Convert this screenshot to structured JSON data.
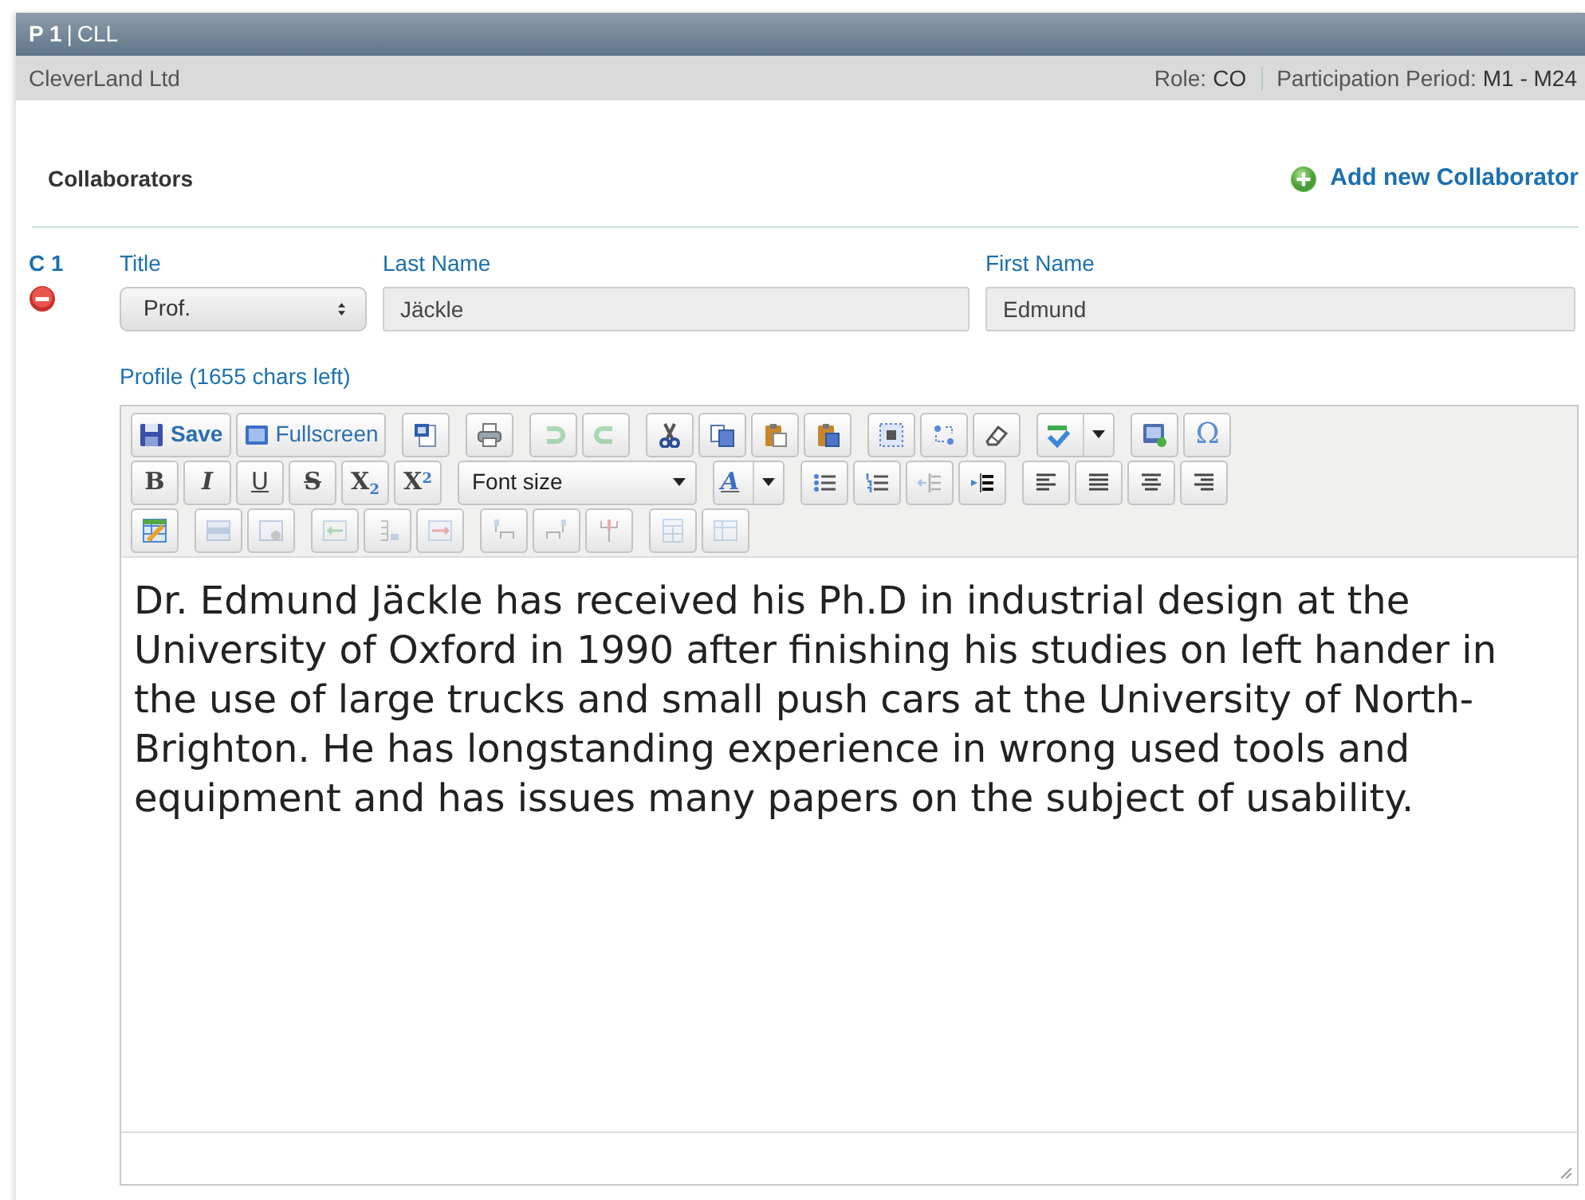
{
  "partner_header": {
    "number": "P 1",
    "separator": "|",
    "acronym": "CLL"
  },
  "partner_info": {
    "name": "CleverLand Ltd",
    "role_label": "Role:",
    "role_value": "CO",
    "period_label": "Participation Period:",
    "period_value": "M1 - M24"
  },
  "collaborators": {
    "title": "Collaborators",
    "add_link": "Add new Collaborator",
    "items": [
      {
        "code": "C 1",
        "title_label": "Title",
        "title_value": "Prof.",
        "last_name_label": "Last Name",
        "last_name": "Jäckle",
        "first_name_label": "First Name",
        "first_name": "Edmund",
        "profile_label": "Profile (1655 chars left)",
        "toolbar": [
          [
            [
              {
                "kind": "text",
                "label": "Save",
                "disabled": false
              },
              {
                "kind": "text",
                "label": "Fullscreen",
                "disabled": false
              }
            ],
            [
              {
                "kind": "icon",
                "disabled": false
              }
            ],
            [
              {
                "kind": "icon",
                "disabled": false
              }
            ],
            [
              {
                "kind": "icon",
                "disabled": true
              },
              {
                "kind": "icon",
                "disabled": true
              }
            ],
            [
              {
                "kind": "icon",
                "disabled": false
              },
              {
                "kind": "icon",
                "disabled": false
              },
              {
                "kind": "icon",
                "disabled": false
              },
              {
                "kind": "icon",
                "disabled": false
              }
            ],
            [
              {
                "kind": "icon",
                "disabled": false
              },
              {
                "kind": "icon",
                "disabled": false
              },
              {
                "kind": "icon",
                "disabled": false
              }
            ],
            [
              {
                "kind": "icon-split",
                "disabled": false
              }
            ],
            [
              {
                "kind": "icon",
                "disabled": false
              },
              {
                "kind": "glyph",
                "label": "Ω",
                "disabled": false
              }
            ]
          ],
          [
            [
              {
                "kind": "glyph",
                "label": "B",
                "disabled": false
              },
              {
                "kind": "glyph",
                "label": "I",
                "disabled": false
              },
              {
                "kind": "glyph",
                "label": "U",
                "disabled": false
              },
              {
                "kind": "glyph",
                "label": "S",
                "disabled": false
              },
              {
                "kind": "glyph",
                "label": "X$_{2}$",
                "disabled": false
              },
              {
                "kind": "glyph",
                "label": "X$^{2}$",
                "disabled": false
              }
            ],
            [
              {
                "kind": "select",
                "label": "Font size",
                "disabled": false
              }
            ],
            [
              {
                "kind": "glyph-split",
                "label": "A",
                "disabled": false
              }
            ],
            [
              {
                "kind": "icon",
                "disabled": false
              },
              {
                "kind": "icon",
                "disabled": false
              },
              {
                "kind": "icon",
                "disabled": true
              },
              {
                "kind": "icon",
                "disabled": false
              }
            ],
            [
              {
                "kind": "icon",
                "disabled": false
              },
              {
                "kind": "icon",
                "disabled": false
              },
              {
                "kind": "icon",
                "disabled": false
              },
              {
                "kind": "icon",
                "disabled": false
              }
            ]
          ],
          [
            [
              {
                "kind": "icon",
                "disabled": false
              }
            ],
            [
              {
                "kind": "icon",
                "disabled": true
              },
              {
                "kind": "icon",
                "disabled": true
              }
            ],
            [
              {
                "kind": "icon",
                "disabled": true
              },
              {
                "kind": "icon",
                "disabled": true
              },
              {
                "kind": "icon",
                "disabled": true
              }
            ],
            [
              {
                "kind": "icon",
                "disabled": true
              },
              {
                "kind": "icon",
                "disabled": true
              },
              {
                "kind": "icon",
                "disabled": true
              }
            ],
            [
              {
                "kind": "icon",
                "disabled": true
              },
              {
                "kind": "icon",
                "disabled": true
              }
            ]
          ]
        ],
        "content": "Dr. Edmund Jäckle has received his Ph.D in industrial design at the University of Oxford in 1990 after finishing his studies on left hander in the use of large trucks and small push cars at the University of North-Brighton. He has longstanding experience in wrong used tools and equipment and has issues many papers on the subject of usability."
      }
    ]
  }
}
